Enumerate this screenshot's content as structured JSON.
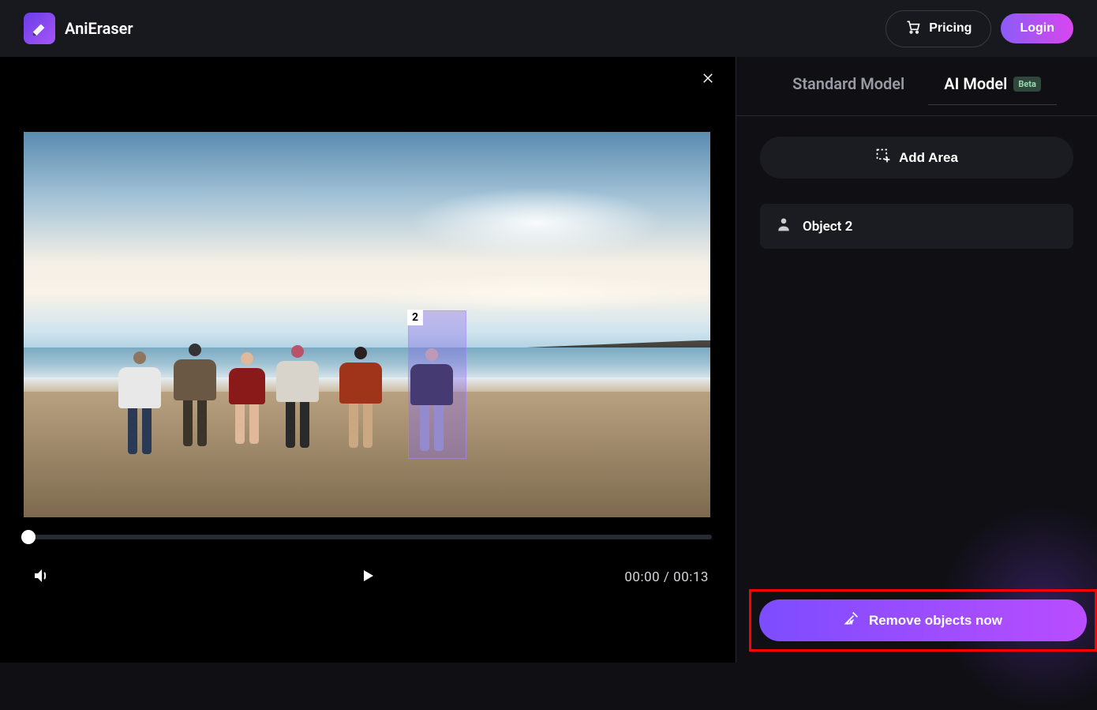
{
  "header": {
    "brand_name": "AniEraser",
    "pricing_label": "Pricing",
    "login_label": "Login"
  },
  "editor": {
    "selection_label": "2",
    "time_current": "00:00",
    "time_total": "00:13",
    "time_separator": " / "
  },
  "panel": {
    "tabs": {
      "standard": "Standard Model",
      "ai": "AI Model",
      "beta_badge": "Beta"
    },
    "add_area_label": "Add Area",
    "object_label": "Object 2",
    "cta_label": "Remove objects now"
  }
}
